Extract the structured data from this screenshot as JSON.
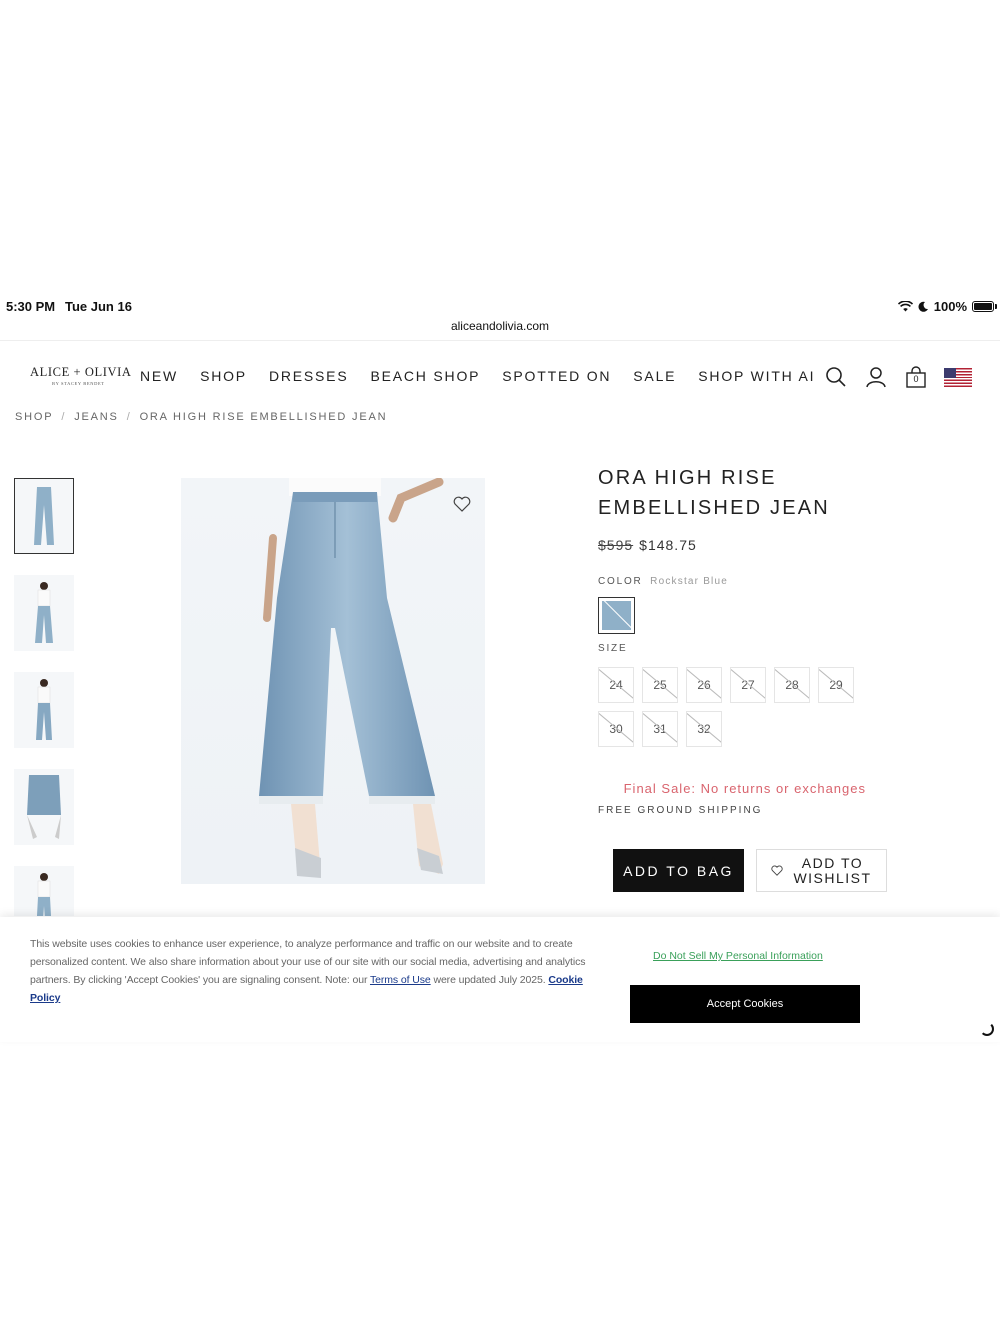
{
  "status_bar": {
    "time": "5:30 PM",
    "date": "Tue Jun 16",
    "battery": "100%",
    "battery_level": 1.0,
    "icons": [
      "wifi-icon",
      "moon-icon",
      "battery-icon"
    ]
  },
  "browser": {
    "url": "aliceandolivia.com"
  },
  "header": {
    "logo": "ALICE + OLIVIA",
    "logo_sub": "BY STACEY BENDET",
    "nav": [
      "NEW",
      "SHOP",
      "DRESSES",
      "BEACH SHOP",
      "SPOTTED ON",
      "SALE",
      "SHOP WITH AI"
    ],
    "cart_count": "0",
    "icons": [
      "search-icon",
      "account-icon",
      "bag-icon",
      "us-flag-icon"
    ]
  },
  "breadcrumb": [
    "SHOP",
    "JEANS",
    "ORA HIGH RISE EMBELLISHED JEAN"
  ],
  "product": {
    "title": "ORA HIGH RISE EMBELLISHED JEAN",
    "price_original": "$595",
    "price_sale": "$148.75",
    "color_label": "COLOR",
    "color_value": "Rockstar Blue",
    "swatch_color": "#8fb0c8",
    "size_label": "SIZE",
    "sizes": [
      "24",
      "25",
      "26",
      "27",
      "28",
      "29",
      "30",
      "31",
      "32"
    ],
    "final_sale": "Final Sale: No returns or exchanges",
    "shipping": "FREE GROUND SHIPPING",
    "add_to_bag": "ADD TO BAG",
    "add_to_wishlist_line1": "ADD TO",
    "add_to_wishlist_line2": "WISHLIST"
  },
  "cookie_banner": {
    "text": "This website uses cookies to enhance user experience, to analyze performance and traffic on our website and to create personalized content. We also share information about your use of our site with our social media, advertising and analytics partners. By clicking 'Accept Cookies' you are signaling consent. Note: our ",
    "terms_link": "Terms of Use",
    "text_after": " were updated July 2025. ",
    "cookie_policy_link": "Cookie Policy",
    "do_not_sell": "Do Not Sell My Personal Information",
    "accept": "Accept Cookies"
  },
  "colors": {
    "final_sale": "#d9646e",
    "do_not_sell": "#3aa05a",
    "denim": "#8fb0c8",
    "link": "#1a3a8a"
  }
}
